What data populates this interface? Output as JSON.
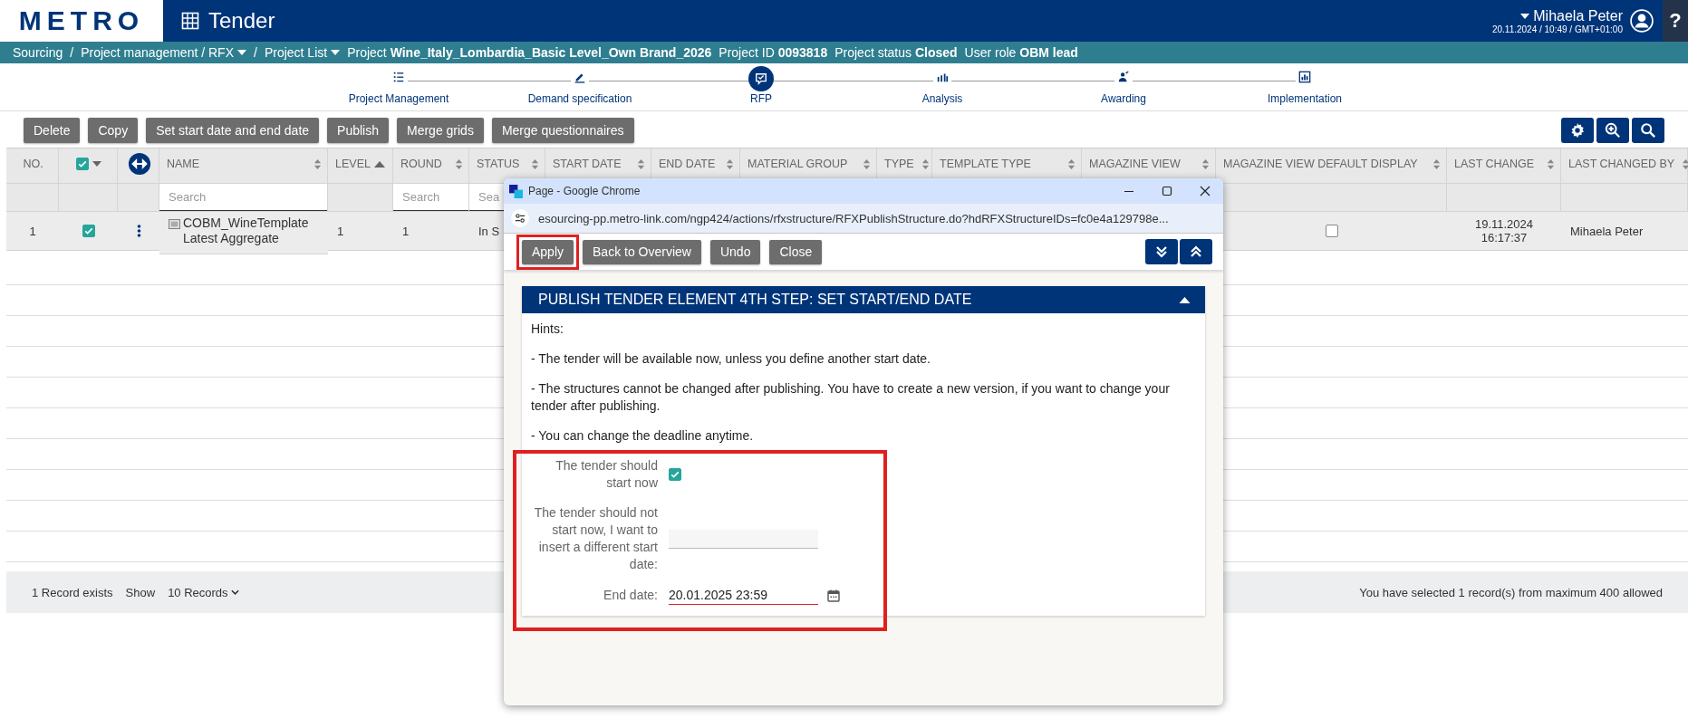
{
  "header": {
    "logo": "METRO",
    "app_title": "Tender",
    "user": "Mihaela Peter",
    "datetime": "20.11.2024 / 10:49 / GMT+01:00",
    "help": "?"
  },
  "breadcrumb": {
    "separator": "/",
    "items": [
      {
        "text": "Sourcing",
        "dropdown": false
      },
      {
        "text": "Project management / RFX",
        "dropdown": true
      },
      {
        "text": "Project List",
        "dropdown": true
      }
    ],
    "info": [
      {
        "label": "Project",
        "value": "Wine_Italy_Lombardia_Basic Level_Own Brand_2026"
      },
      {
        "label": "Project ID",
        "value": "0093818"
      },
      {
        "label": "Project status",
        "value": "Closed"
      },
      {
        "label": "User role",
        "value": "OBM lead"
      }
    ]
  },
  "steps": [
    {
      "label": "Project Management",
      "selected": false
    },
    {
      "label": "Demand specification",
      "selected": false
    },
    {
      "label": "RFP",
      "selected": true
    },
    {
      "label": "Analysis",
      "selected": false
    },
    {
      "label": "Awarding",
      "selected": false
    },
    {
      "label": "Implementation",
      "selected": false
    }
  ],
  "toolbar": {
    "buttons": [
      "Delete",
      "Copy",
      "Set start date and end date",
      "Publish",
      "Merge grids",
      "Merge questionnaires"
    ]
  },
  "table": {
    "all_checked": true,
    "columns": [
      {
        "kind": "text",
        "label": "NO."
      },
      {
        "kind": "select"
      },
      {
        "kind": "expand"
      },
      {
        "kind": "text",
        "label": "NAME",
        "sortable": true,
        "placeholder": "Search"
      },
      {
        "kind": "text",
        "label": "LEVEL",
        "sortable": true,
        "ascending": true
      },
      {
        "kind": "text",
        "label": "ROUND",
        "sortable": true,
        "placeholder": "Search"
      },
      {
        "kind": "text",
        "label": "STATUS",
        "sortable": true,
        "placeholder": "Sea"
      },
      {
        "kind": "text",
        "label": "START DATE",
        "sortable": true
      },
      {
        "kind": "text",
        "label": "END DATE",
        "sortable": true
      },
      {
        "kind": "text",
        "label": "MATERIAL GROUP",
        "sortable": true
      },
      {
        "kind": "text",
        "label": "TYPE",
        "sortable": true
      },
      {
        "kind": "text",
        "label": "TEMPLATE TYPE",
        "sortable": true
      },
      {
        "kind": "text",
        "label": "MAGAZINE VIEW",
        "sortable": true
      },
      {
        "kind": "text",
        "label": "MAGAZINE VIEW DEFAULT DISPLAY",
        "sortable": true
      },
      {
        "kind": "text",
        "label": "LAST CHANGE",
        "sortable": true
      },
      {
        "kind": "text",
        "label": "LAST CHANGED BY",
        "sortable": true
      }
    ],
    "rows": [
      {
        "no": "1",
        "checked": true,
        "name": "COBM_WineTemplate Latest Aggregate",
        "level": "1",
        "round": "1",
        "status": "In S",
        "magazine_default": false,
        "last_change": "19.11.2024 16:17:37",
        "last_changed_by": "Mihaela Peter"
      }
    ]
  },
  "footer": {
    "records": "1 Record exists",
    "show": "Show",
    "page_size": "10 Records",
    "selection": "You have selected 1 record(s) from maximum 400 allowed"
  },
  "dialog": {
    "title": "Page - Google Chrome",
    "url": "esourcing-pp.metro-link.com/ngp424/actions/rfxstructure/RFXPublishStructure.do?hdRFXStructureIDs=fc0e4a129798e...",
    "buttons": [
      {
        "label": "Apply",
        "highlighted": true
      },
      {
        "label": "Back to Overview",
        "highlighted": false
      },
      {
        "label": "Undo",
        "highlighted": false
      },
      {
        "label": "Close",
        "highlighted": false
      }
    ],
    "panel": {
      "title": "PUBLISH TENDER ELEMENT 4TH STEP: SET START/END DATE",
      "expanded": true,
      "hints_label": "Hints:",
      "hints": [
        "- The tender will be available now, unless you define another start date.",
        "- The structures cannot be changed after publishing. You have to create a new version, if you want to change your tender after publishing.",
        "- You can change the deadline anytime."
      ],
      "form": {
        "highlighted": true,
        "start_now": {
          "label": "The tender should start now",
          "checked": true
        },
        "start_date": {
          "label": "The tender should not start now, I want to insert a different start date:"
        },
        "end_date": {
          "label": "End date:",
          "value": "20.01.2025 23:59"
        }
      }
    }
  }
}
